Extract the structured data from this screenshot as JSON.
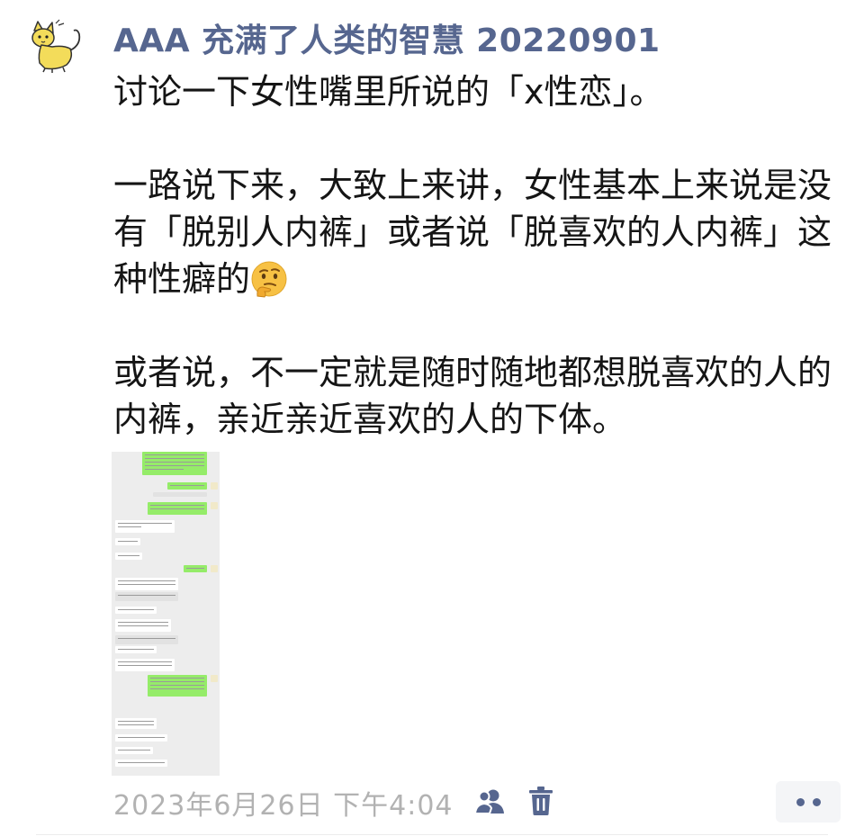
{
  "post": {
    "author": "AAA 充满了人类的智慧 20220901",
    "paragraphs": [
      "讨论一下女性嘴里所说的「x性恋」。",
      "一路说下来，大致上来讲，女性基本上来说是没有「脱别人内裤」或者说「脱喜欢的人内裤」这种性癖的",
      "或者说，不一定就是随时随地都想脱喜欢的人的内裤，亲近亲近喜欢的人的下体。"
    ],
    "emoji": "thinking-face",
    "timestamp": "2023年6月26日 下午4:04"
  },
  "colors": {
    "author": "#56668f",
    "timestamp": "#b2b2b2",
    "chat_bubble_green": "#95ec69",
    "chat_background": "#ededed"
  }
}
